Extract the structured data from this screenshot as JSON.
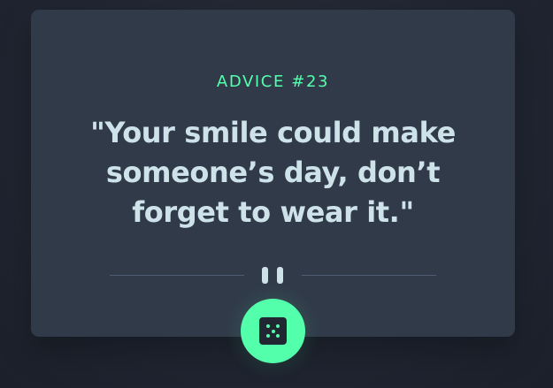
{
  "advice": {
    "title": "ADVICE #23",
    "quote": "\"Your smile could make someone’s day, don’t forget to wear it.\""
  },
  "icons": {
    "divider": "pause-icon",
    "button": "dice-icon"
  },
  "colors": {
    "background": "#1f2430",
    "card": "#313a49",
    "accent": "#53ffab",
    "text": "#cee3e9",
    "divider": "#4f5d73"
  }
}
